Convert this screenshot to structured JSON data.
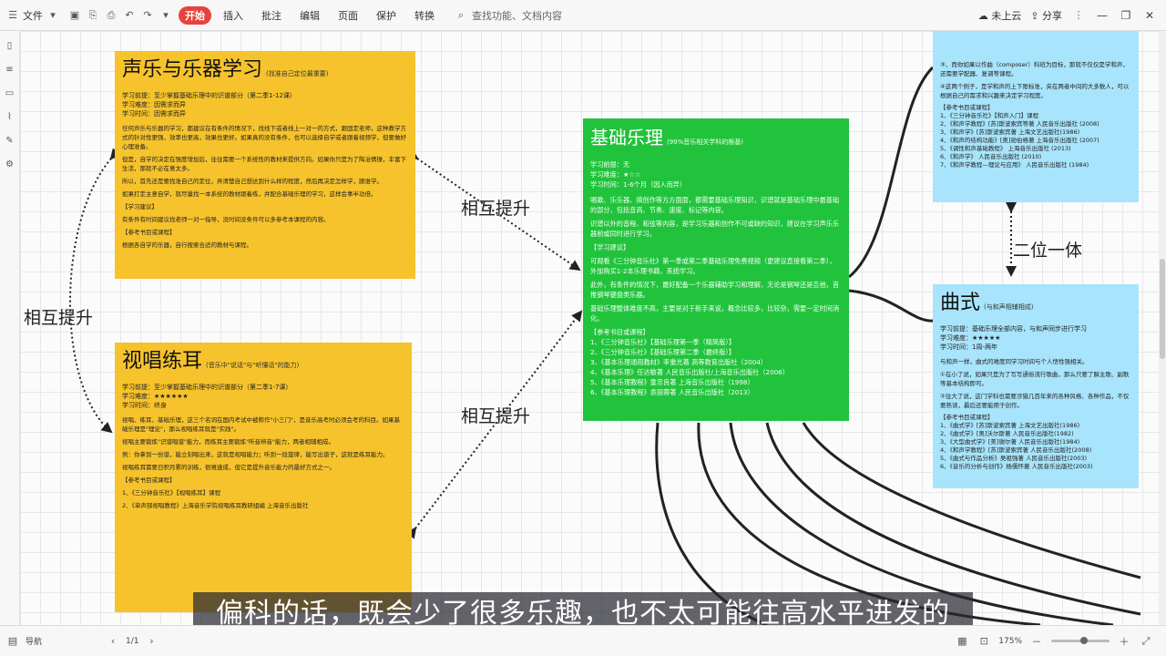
{
  "toolbar": {
    "file_label": "文件",
    "tabs": [
      "开始",
      "插入",
      "批注",
      "编辑",
      "页面",
      "保护",
      "转换"
    ],
    "search_placeholder": "查找功能、文档内容",
    "status": "未上云",
    "share": "分享"
  },
  "cards": {
    "music": {
      "title": "声乐与乐器学习",
      "sub": "(找准自己定位最重要)",
      "meta": [
        "学习前提：至少掌握基础乐理中的识谱部分（第二季1-12课）",
        "学习难度：因需求而异",
        "学习时间：因需求而异"
      ],
      "paras": [
        "任何声乐与乐器的学习，都建议在有条件的情况下，找线下或者线上一对一的方式，跟固定老师，这种教学方式的针对性更强，效率也更高，效果也更好。如果真的没有条件，也可以选择自学或者跟着视频学，但要做好心理准备。",
        "但是，自学的决定在强度增加后，往往需要一个系统性的教材来提供方向。如果你只是为了陶冶情操，丰富下生活，那就不必在意太多。",
        "所以，首先还是要找准自己的定位，弄清楚自己想达到什么样的程度，然后再决定怎样学，跟谁学。",
        "如果打定主意自学，就尽量找一本系统的教材跟着练，并配合基础乐理的学习，这样会事半功倍。",
        "【学习建议】",
        "有条件有时间建议找老师一对一指导，没时间没条件可以多参考本课程的内容。",
        "【参考书目或课程】",
        "根据各自学的乐器，自行搜索合适的教材与课程。"
      ]
    },
    "theory": {
      "title": "基础乐理",
      "sub": "(99%音乐相关学科的根基)",
      "meta": [
        "学习前提：无",
        "学习难度：★☆☆",
        "学习时间：1-6个月（因人而异）"
      ],
      "paras": [
        "唱歌、乐乐器、搞创作等方方面面，都需要基础乐理知识，识谱就是基础乐理中最基础的部分，包括音高、节奏、速度、标记等内容。",
        "识谱以外的音程、和弦等内容，是学习乐器和创作不可或缺的知识，建议在学习声乐乐器前或同时进行学习。",
        "【学习建议】",
        "可观看《三分钟音乐社》第一季或第二季基础乐理免费视频（更建议直接看第二季），外加购买1-2本乐理书籍，系统学习。",
        "此外，有条件的情况下，最好配备一个乐器辅助学习和理解，无论是钢琴还是吉他，首推钢琴键盘类乐器。",
        "基础乐理整体难度不高，主要是对于新手来说，概念比较多，比较杂，需要一定时间消化。"
      ],
      "refs_title": "【参考书目或课程】",
      "refs": [
        "1、《三分钟音乐社》【基础乐理第一季（精简版）】",
        "2、《三分钟音乐社》【基础乐理第二季（最终版）】",
        "3、《基本乐理通用教材》李重光著 高等教育出版社（2004）",
        "4、《基本乐理》任达敏著 人民音乐出版社/上海音乐出版社（2006）",
        "5、《基本乐理教程》童忠良著 上海音乐出版社（1998）",
        "6、《基本乐理教程》袁丽蓉著 人民音乐出版社（2013）"
      ]
    },
    "ear": {
      "title": "视唱练耳",
      "sub": "(音乐中\"说话\"与\"听懂话\"的能力)",
      "meta": [
        "学习前提：至少掌握基础乐理中的识谱部分（第二季1-7课）",
        "学习难度：★★★★★★",
        "学习时间：终身"
      ],
      "paras": [
        "视唱、练耳、基础乐理，这三个名词在国内考试中被称作\"小三门\"，是音乐高考时必须会考的科目。如果基础乐理是\"理论\"，那么视唱练耳就是\"实践\"。",
        "视唱主要锻炼\"识谱唱谱\"能力，而练耳主要锻炼\"听音辨音\"能力，两者相辅相成。",
        "例：你拿到一份谱，能立刻唱出来，这就是视唱能力；听到一段旋律，能写出谱子，这就是练耳能力。",
        "视唱练耳需要日积月累的训练，很难速成，但它是提升音乐能力的最好方式之一。",
        "【参考书目或课程】",
        "1、《三分钟音乐社》【视唱练耳】课程",
        "2、《单声部视唱教程》上海音乐学院视唱练耳教研组编 上海音乐出版社"
      ]
    },
    "form": {
      "title": "曲式",
      "sub": "(与和声相辅相成)",
      "meta": [
        "学习前提：基础乐理全部内容，与和声同步进行学习",
        "学习难度：★★★★★",
        "学习时间：1周-两年"
      ],
      "paras": [
        "与和声一样，曲式的难度同学习时间与个人悟性强相关。",
        "①在小了说，如果只是为了写写通俗流行歌曲，那么只要了解主歌、副歌等基本结构即可。",
        "②往大了说，这门学科也需要涉猎几百年来的各种风格、各种作品，不仅要熟读，最后还要能用于创作。"
      ],
      "refs_title": "【参考书目或课程】",
      "refs": [
        "1、《曲式学》[苏]斯波索宾著 上海文艺出版社(1986)",
        "2、《曲式学》[奥]沃尔斯著 人民音乐出版社(1982)",
        "3、《大型曲式学》[美]谢尔著 人民音乐出版社(1984)",
        "4、《和声学教程》[苏]斯波索宾著 人民音乐出版社(2008)",
        "5、《曲式与作品分析》吴祖强著 人民音乐出版社(2003)",
        "6、《音乐的分析与创作》杨儒怀著 人民音乐出版社(2003)"
      ]
    },
    "harmony": {
      "paras": [
        "③、而你如果以作曲（composer）科班为目标，那就不仅仅是学和声，还需要学配器、复调等课程。",
        "④这两个例子，是学和声的上下限标准，央在两者中间的大多数人，可以根据自己的需求和兴趣来决定学习程度。"
      ],
      "refs_title": "【参考书目或课程】",
      "refs": [
        "1、《三分钟音乐社》【和声入门】课程",
        "2、《和声学教程》[苏]斯波索宾等著 人民音乐出版社 (2008)",
        "3、《和声学》[苏]斯波索宾著 上海文艺出版社(1986)",
        "4、《和声的结构功能》[奥]勋伯格著 上海音乐出版社 (2007)",
        "5、《调性和声基础教程》 上海音乐出版社 (2013)",
        "6、《和声学》 人民音乐出版社 (2010)",
        "7、《和声学教程—理论与应用》 人民音乐出版社 (1984)"
      ]
    }
  },
  "relations": [
    "相互提升",
    "相互提升",
    "相互提升",
    "二位一体"
  ],
  "subtitle": "偏科的话，既会少了很多乐趣，也不太可能往高水平进发的",
  "statusbar": {
    "nav": "导航",
    "page": "1/1",
    "zoom": "175%"
  }
}
